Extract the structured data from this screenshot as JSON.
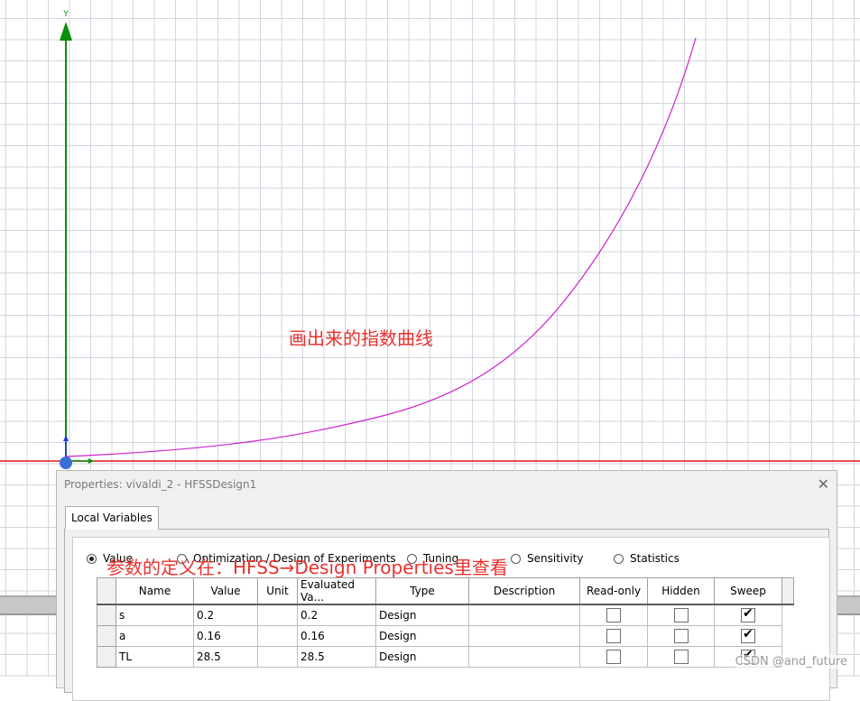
{
  "viewport": {
    "axis_y_label": "Y",
    "colors": {
      "grid": "#d4d4e0",
      "y_axis": "#0a8f0a",
      "x_axis": "#e0191d",
      "curve": "#cc22cc",
      "origin": "#3a6fd8",
      "annotation": "#e8322e"
    },
    "annotation_curve": "画出来的指数曲线"
  },
  "dialog": {
    "title": "Properties: vivaldi_2 - HFSSDesign1",
    "close_icon": "close-icon",
    "tab_label": "Local Variables",
    "radios": [
      {
        "label": "Value",
        "checked": true
      },
      {
        "label": "Optimization / Design of Experiments",
        "checked": false
      },
      {
        "label": "Tuning",
        "checked": false
      },
      {
        "label": "Sensitivity",
        "checked": false
      },
      {
        "label": "Statistics",
        "checked": false
      }
    ],
    "annotation_properties": "参数的定义在：HFSS→Design Properties里查看",
    "table": {
      "headers": [
        "Name",
        "Value",
        "Unit",
        "Evaluated Va...",
        "Type",
        "Description",
        "Read-only",
        "Hidden",
        "Sweep"
      ],
      "rows": [
        {
          "name": "s",
          "value": "0.2",
          "unit": "",
          "evaluated": "0.2",
          "type": "Design",
          "description": "",
          "read_only": false,
          "hidden": false,
          "sweep": true
        },
        {
          "name": "a",
          "value": "0.16",
          "unit": "",
          "evaluated": "0.16",
          "type": "Design",
          "description": "",
          "read_only": false,
          "hidden": false,
          "sweep": true
        },
        {
          "name": "TL",
          "value": "28.5",
          "unit": "",
          "evaluated": "28.5",
          "type": "Design",
          "description": "",
          "read_only": false,
          "hidden": false,
          "sweep": true
        }
      ]
    }
  },
  "watermark": "CSDN @and_future"
}
